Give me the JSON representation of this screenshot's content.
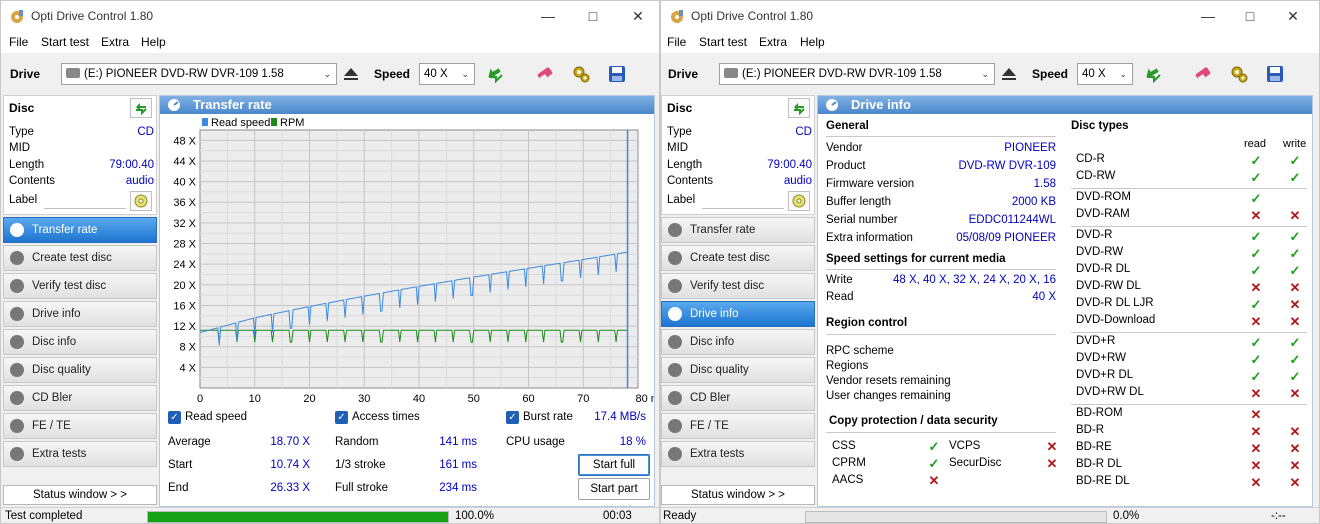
{
  "app_title": "Opti Drive Control 1.80",
  "menu": [
    "File",
    "Start test",
    "Extra",
    "Help"
  ],
  "drive": {
    "label": "Drive",
    "selected": "(E:)  PIONEER DVD-RW  DVR-109 1.58",
    "speed_label": "Speed",
    "speed_value": "40 X"
  },
  "disc": {
    "header": "Disc",
    "rows": [
      {
        "k": "Type",
        "v": "CD"
      },
      {
        "k": "MID",
        "v": ""
      },
      {
        "k": "Length",
        "v": "79:00.40"
      },
      {
        "k": "Contents",
        "v": "audio"
      }
    ],
    "label_field": "Label"
  },
  "nav": [
    "Transfer rate",
    "Create test disc",
    "Verify test disc",
    "Drive info",
    "Disc info",
    "Disc quality",
    "CD Bler",
    "FE / TE",
    "Extra tests"
  ],
  "nav_active_left": "Transfer rate",
  "nav_active_right": "Drive info",
  "status_window_btn": "Status window > >",
  "transfer": {
    "title": "Transfer rate",
    "checks": {
      "read_speed": "Read speed",
      "access_times": "Access times",
      "burst_rate": "Burst rate"
    },
    "burst_value": "17.4 MB/s",
    "stats_left": [
      {
        "k": "Average",
        "v": "18.70 X"
      },
      {
        "k": "Start",
        "v": "10.74 X"
      },
      {
        "k": "End",
        "v": "26.33 X"
      }
    ],
    "stats_mid": [
      {
        "k": "Random",
        "v": "141 ms"
      },
      {
        "k": "1/3 stroke",
        "v": "161 ms"
      },
      {
        "k": "Full stroke",
        "v": "234 ms"
      }
    ],
    "cpu_label": "CPU usage",
    "cpu_value": "18 %",
    "start_full": "Start full",
    "start_part": "Start part"
  },
  "chart_data": {
    "type": "line",
    "legend": [
      "Read speed",
      "RPM"
    ],
    "legend_placement": "top-left",
    "x_unit": "min",
    "xlim": [
      0,
      80
    ],
    "ylim": [
      0,
      50
    ],
    "x_ticks": [
      0,
      10,
      20,
      30,
      40,
      50,
      60,
      70,
      80
    ],
    "x_tick_labels": [
      "0",
      "10",
      "20",
      "30",
      "40",
      "50",
      "60",
      "70",
      "80 min"
    ],
    "y_ticks": [
      4,
      8,
      12,
      16,
      20,
      24,
      28,
      32,
      36,
      40,
      44,
      48
    ],
    "y_tick_labels": [
      "4 X",
      "8 X",
      "12 X",
      "16 X",
      "20 X",
      "24 X",
      "28 X",
      "32 X",
      "36 X",
      "40 X",
      "44 X",
      "48 X"
    ],
    "grid": true,
    "series": [
      {
        "name": "Read speed",
        "color": "#3a8ae0",
        "x": [
          0,
          10,
          20,
          30,
          40,
          50,
          60,
          70,
          78
        ],
        "y": [
          10.74,
          13.6,
          15.8,
          17.8,
          19.7,
          21.5,
          23.2,
          24.9,
          26.33
        ]
      },
      {
        "name": "RPM",
        "color": "#1d8a1d",
        "x": [
          0,
          78
        ],
        "y": [
          11.2,
          11.2
        ]
      }
    ]
  },
  "drive_info": {
    "title": "Drive info",
    "general_header": "General",
    "general": [
      {
        "k": "Vendor",
        "v": "PIONEER"
      },
      {
        "k": "Product",
        "v": "DVD-RW  DVR-109"
      },
      {
        "k": "Firmware version",
        "v": "1.58"
      },
      {
        "k": "Buffer length",
        "v": "2000 KB"
      },
      {
        "k": "Serial number",
        "v": "EDDC011244WL"
      },
      {
        "k": "Extra information",
        "v": "05/08/09  PIONEER"
      }
    ],
    "speed_header": "Speed settings for current media",
    "speed": [
      {
        "k": "Write",
        "v": "48 X, 40 X, 32 X, 24 X, 20 X, 16"
      },
      {
        "k": "Read",
        "v": "40 X"
      }
    ],
    "region_header": "Region control",
    "region": [
      "RPC scheme",
      "Regions",
      "Vendor resets remaining",
      "User changes remaining"
    ],
    "protect_header": "Copy protection / data security",
    "protect": [
      {
        "k": "CSS",
        "v": true
      },
      {
        "k": "VCPS",
        "v": false
      },
      {
        "k": "CPRM",
        "v": true
      },
      {
        "k": "SecurDisc",
        "v": false
      },
      {
        "k": "AACS",
        "v": false
      }
    ],
    "disc_types_header": "Disc types",
    "col_read": "read",
    "col_write": "write",
    "disc_types": [
      {
        "n": "CD-R",
        "r": true,
        "w": true
      },
      {
        "n": "CD-RW",
        "r": true,
        "w": true
      },
      {
        "n": "DVD-ROM",
        "r": true,
        "w": null
      },
      {
        "n": "DVD-RAM",
        "r": false,
        "w": false
      },
      {
        "n": "DVD-R",
        "r": true,
        "w": true
      },
      {
        "n": "DVD-RW",
        "r": true,
        "w": true
      },
      {
        "n": "DVD-R DL",
        "r": true,
        "w": true
      },
      {
        "n": "DVD-RW DL",
        "r": false,
        "w": false
      },
      {
        "n": "DVD-R DL LJR",
        "r": true,
        "w": false
      },
      {
        "n": "DVD-Download",
        "r": false,
        "w": false
      },
      {
        "n": "DVD+R",
        "r": true,
        "w": true
      },
      {
        "n": "DVD+RW",
        "r": true,
        "w": true
      },
      {
        "n": "DVD+R DL",
        "r": true,
        "w": true
      },
      {
        "n": "DVD+RW DL",
        "r": false,
        "w": false
      },
      {
        "n": "BD-ROM",
        "r": false,
        "w": null
      },
      {
        "n": "BD-R",
        "r": false,
        "w": false
      },
      {
        "n": "BD-RE",
        "r": false,
        "w": false
      },
      {
        "n": "BD-R DL",
        "r": false,
        "w": false
      },
      {
        "n": "BD-RE DL",
        "r": false,
        "w": false
      }
    ]
  },
  "status_left": {
    "text": "Test completed",
    "progress": 100,
    "progress_text": "100.0%",
    "time": "00:03"
  },
  "status_right": {
    "text": "Ready",
    "progress": 0,
    "progress_text": "0.0%",
    "time": "-:--"
  }
}
